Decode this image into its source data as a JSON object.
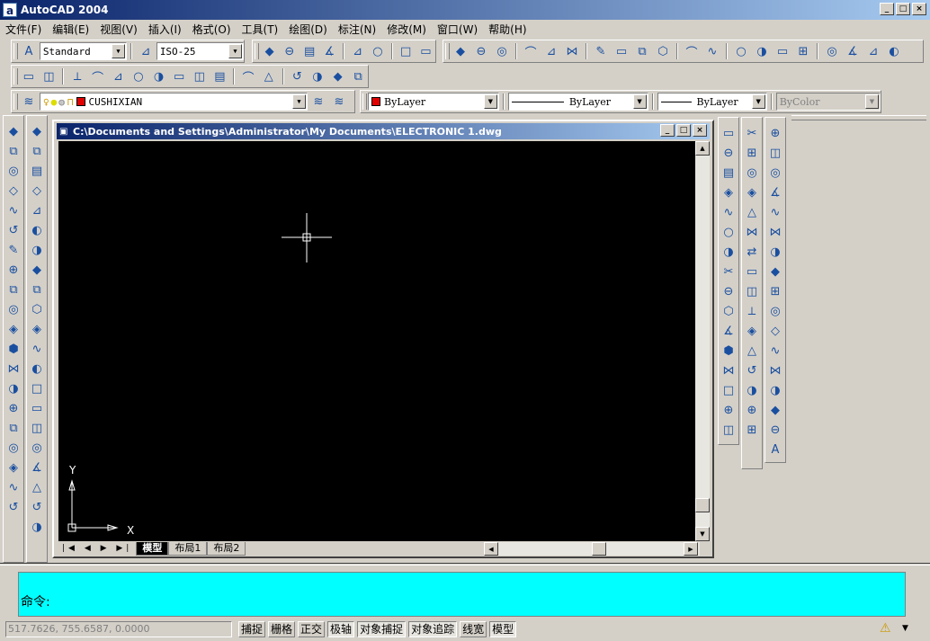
{
  "app": {
    "title": "AutoCAD 2004",
    "logo": "a"
  },
  "window_buttons": [
    "_",
    "□",
    "×"
  ],
  "menu": [
    "文件(F)",
    "编辑(E)",
    "视图(V)",
    "插入(I)",
    "格式(O)",
    "工具(T)",
    "绘图(D)",
    "标注(N)",
    "修改(M)",
    "窗口(W)",
    "帮助(H)"
  ],
  "styles_toolbar": {
    "text_style": "Standard",
    "dim_style": "ISO-25"
  },
  "zoom_toolbar": {
    "icons": [
      "zoom-window",
      "zoom-extents",
      "zoom-scale",
      "zoom-center",
      "zoom-in",
      "zoom-out",
      "zoom-all",
      "zoom-dynamic"
    ]
  },
  "standard_toolbar": {
    "icons": [
      "new",
      "open",
      "save",
      "print",
      "preview",
      "publish",
      "cut",
      "copy",
      "paste",
      "match-properties",
      "undo",
      "redo",
      "pan",
      "zoom-realtime",
      "zoom-window",
      "zoom-previous",
      "properties",
      "design-center",
      "tool-palettes",
      "help"
    ]
  },
  "solids_toolbar": {
    "icons": [
      "interfere",
      "slice",
      "box",
      "wedge",
      "pyramid",
      "cone",
      "sphere",
      "dome",
      "dish",
      "torus",
      "edge-surface",
      "3d-mesh",
      "revolved-surface",
      "tabulated-surface",
      "ruled-surface",
      "edge"
    ]
  },
  "layers": {
    "current": "CUSHIXIAN",
    "color": "#e00000"
  },
  "properties": {
    "color": "ByLayer",
    "linetype": "ByLayer",
    "lineweight": "ByLayer",
    "plotstyle": "ByColor"
  },
  "left_toolbar_1": [
    "box",
    "sphere",
    "cylinder",
    "cone",
    "wedge",
    "torus",
    "extrude",
    "revolve",
    "slice",
    "section",
    "interfere",
    "setup-drawing",
    "setup-view",
    "setup-profile",
    "solid-view",
    "3d-orbit",
    "3d-box",
    "3d-wedge",
    "3d-dish",
    "3d-mesh"
  ],
  "left_toolbar_2": [
    "text-2d",
    "shaded",
    "hidden",
    "flat",
    "gouraud",
    "render",
    "lights",
    "scenes",
    "union",
    "subtract",
    "intersect",
    "extrude-face",
    "move-face",
    "offset-face",
    "delete-face",
    "rotate-face",
    "taper-face",
    "copy-face",
    "color-face",
    "imprint",
    "separate"
  ],
  "modify_toolbar": [
    "erase",
    "copy",
    "mirror",
    "offset",
    "array",
    "move",
    "rotate",
    "scale",
    "stretch",
    "trim",
    "extend",
    "break",
    "break-at-point",
    "chamfer",
    "fillet",
    "explode"
  ],
  "dimension_toolbar": [
    "linear",
    "aligned",
    "ordinate",
    "radius",
    "diameter",
    "angular",
    "quick-dim",
    "baseline",
    "continue",
    "leader",
    "tolerance",
    "center-mark",
    "dim-edit",
    "dim-text-edit",
    "dim-update",
    "dim-style"
  ],
  "draw_toolbar": [
    "line",
    "construction-line",
    "polyline",
    "polygon",
    "rectangle",
    "arc",
    "circle",
    "revision-cloud",
    "spline",
    "ellipse",
    "ellipse-arc",
    "insert-block",
    "make-block",
    "point",
    "hatch",
    "region",
    "multiline-text"
  ],
  "drawing": {
    "title": "C:\\Documents and Settings\\Administrator\\My Documents\\ELECTRONIC 1.dwg",
    "ucs_x": "X",
    "ucs_y": "Y",
    "tabs": [
      "模型",
      "布局1",
      "布局2"
    ]
  },
  "command": {
    "prompt": "命令:"
  },
  "status": {
    "coords": "517.7626, 755.6587, 0.0000",
    "buttons": [
      {
        "label": "捕捉",
        "on": false
      },
      {
        "label": "栅格",
        "on": false
      },
      {
        "label": "正交",
        "on": false
      },
      {
        "label": "极轴",
        "on": true
      },
      {
        "label": "对象捕捉",
        "on": true
      },
      {
        "label": "对象追踪",
        "on": true
      },
      {
        "label": "线宽",
        "on": false
      },
      {
        "label": "模型",
        "on": true
      }
    ]
  }
}
